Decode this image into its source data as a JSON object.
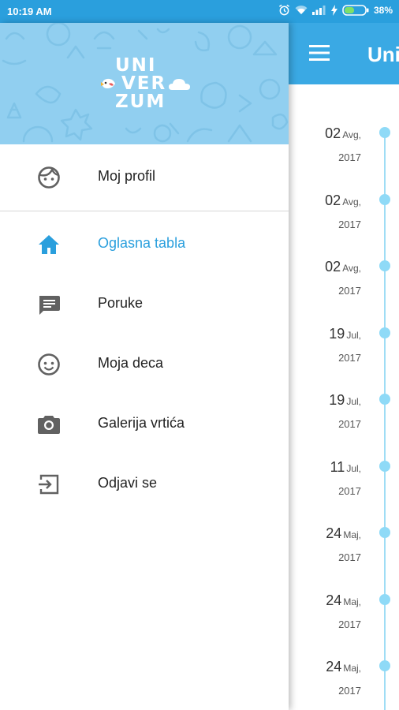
{
  "status_bar": {
    "time": "10:19 AM",
    "battery": "38%"
  },
  "app_bar": {
    "title": "Uni"
  },
  "drawer": {
    "logo": {
      "line1": "UNI",
      "line2": "VER",
      "line3": "ZUM"
    },
    "menu": [
      {
        "label": "Moj profil",
        "icon": "face-icon",
        "active": false
      },
      {
        "label": "Oglasna tabla",
        "icon": "home-icon",
        "active": true
      },
      {
        "label": "Poruke",
        "icon": "message-icon",
        "active": false
      },
      {
        "label": "Moja deca",
        "icon": "child-face-icon",
        "active": false
      },
      {
        "label": "Galerija vrtića",
        "icon": "camera-icon",
        "active": false
      },
      {
        "label": "Odjavi se",
        "icon": "logout-icon",
        "active": false
      }
    ]
  },
  "timeline": [
    {
      "day": "02",
      "month": "Avg,",
      "year": "2017"
    },
    {
      "day": "02",
      "month": "Avg,",
      "year": "2017"
    },
    {
      "day": "02",
      "month": "Avg,",
      "year": "2017"
    },
    {
      "day": "19",
      "month": "Jul,",
      "year": "2017"
    },
    {
      "day": "19",
      "month": "Jul,",
      "year": "2017"
    },
    {
      "day": "11",
      "month": "Jul,",
      "year": "2017"
    },
    {
      "day": "24",
      "month": "Maj,",
      "year": "2017"
    },
    {
      "day": "24",
      "month": "Maj,",
      "year": "2017"
    },
    {
      "day": "24",
      "month": "Maj,",
      "year": "2017"
    }
  ],
  "colors": {
    "primary": "#2a9fdd",
    "header": "#91cff0",
    "timeline_dot": "#8fdaf7"
  }
}
